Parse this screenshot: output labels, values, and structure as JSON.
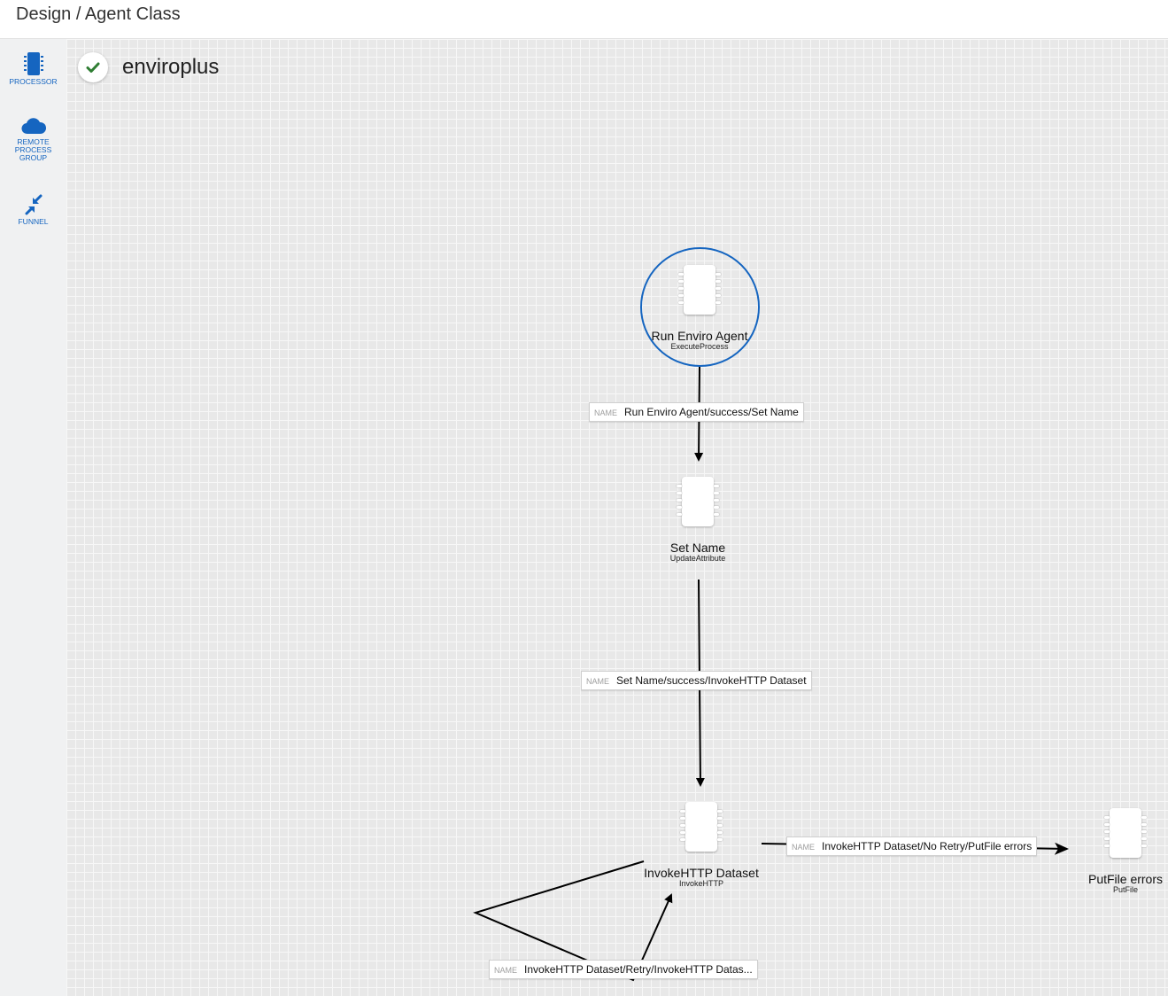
{
  "header": {
    "breadcrumb": "Design / Agent Class"
  },
  "sidebar": {
    "tools": [
      {
        "id": "processor",
        "label": "PROCESSOR",
        "icon": "processor-chip-icon"
      },
      {
        "id": "rpg",
        "label": "REMOTE\nPROCESS\nGROUP",
        "icon": "cloud-icon"
      },
      {
        "id": "funnel",
        "label": "FUNNEL",
        "icon": "funnel-collapse-icon"
      }
    ],
    "accent": "#1565c0"
  },
  "flow": {
    "name": "enviroplus",
    "status": "valid",
    "status_icon": "check-icon",
    "status_color": "#2e7d32",
    "processors": [
      {
        "name": "Run Enviro Agent",
        "type": "ExecuteProcess",
        "selected": true
      },
      {
        "name": "Set Name",
        "type": "UpdateAttribute"
      },
      {
        "name": "InvokeHTTP Dataset",
        "type": "InvokeHTTP"
      },
      {
        "name": "PutFile errors",
        "type": "PutFile"
      }
    ],
    "connections": [
      {
        "key": "NAME",
        "value": "Run Enviro Agent/success/Set Name"
      },
      {
        "key": "NAME",
        "value": "Set Name/success/InvokeHTTP Dataset"
      },
      {
        "key": "NAME",
        "value": "InvokeHTTP Dataset/No Retry/PutFile errors"
      },
      {
        "key": "NAME",
        "value": "InvokeHTTP Dataset/Retry/InvokeHTTP Datas..."
      }
    ]
  }
}
